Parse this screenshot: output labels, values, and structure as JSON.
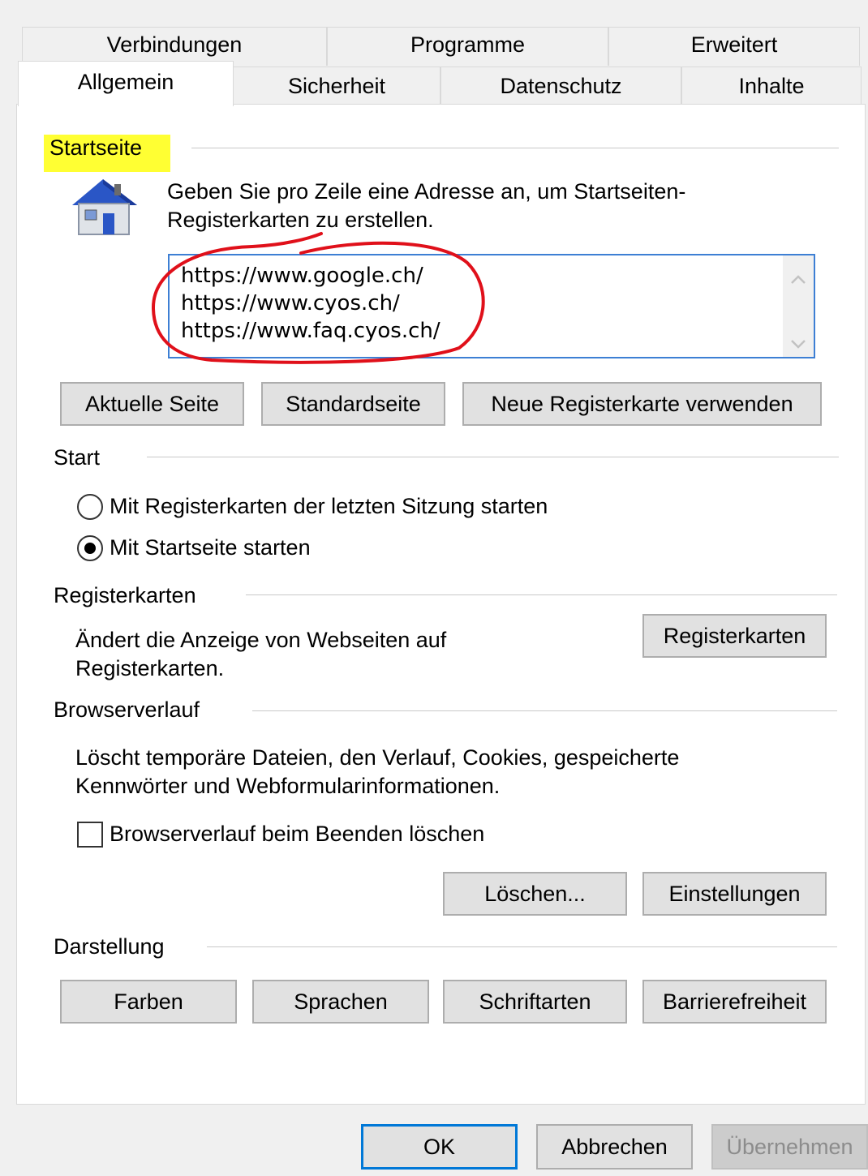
{
  "tabs": {
    "row1": [
      "Verbindungen",
      "Programme",
      "Erweitert"
    ],
    "row2": [
      "Allgemein",
      "Sicherheit",
      "Datenschutz",
      "Inhalte"
    ],
    "active": "Allgemein"
  },
  "startseite": {
    "title": "Startseite",
    "description_line1": "Geben Sie pro Zeile eine Adresse an, um Startseiten-",
    "description_line2": "Registerkarten zu erstellen.",
    "urls": [
      "https://www.google.ch/",
      "https://www.cyos.ch/",
      "https://www.faq.cyos.ch/"
    ],
    "buttons": {
      "current": "Aktuelle Seite",
      "default": "Standardseite",
      "new_tab": "Neue Registerkarte verwenden"
    },
    "highlight_color": "#ffff33",
    "annotation_color": "#e0101a"
  },
  "start": {
    "title": "Start",
    "options": [
      {
        "label": "Mit Registerkarten der letzten Sitzung starten",
        "selected": false
      },
      {
        "label": "Mit Startseite starten",
        "selected": true
      }
    ]
  },
  "registerkarten": {
    "title": "Registerkarten",
    "description_line1": "Ändert die Anzeige von Webseiten auf",
    "description_line2": "Registerkarten.",
    "button": "Registerkarten"
  },
  "browserverlauf": {
    "title": "Browserverlauf",
    "description_line1": "Löscht temporäre Dateien, den Verlauf, Cookies, gespeicherte",
    "description_line2": "Kennwörter und Webformularinformationen.",
    "checkbox_label": "Browserverlauf beim Beenden löschen",
    "checkbox_checked": false,
    "delete_button": "Löschen...",
    "settings_button": "Einstellungen"
  },
  "darstellung": {
    "title": "Darstellung",
    "buttons": [
      "Farben",
      "Sprachen",
      "Schriftarten",
      "Barrierefreiheit"
    ]
  },
  "dialog_buttons": {
    "ok": "OK",
    "cancel": "Abbrechen",
    "apply": "Übernehmen"
  },
  "icons": {
    "home": "house-icon",
    "scroll_up": "chevron-up-icon",
    "scroll_down": "chevron-down-icon"
  }
}
